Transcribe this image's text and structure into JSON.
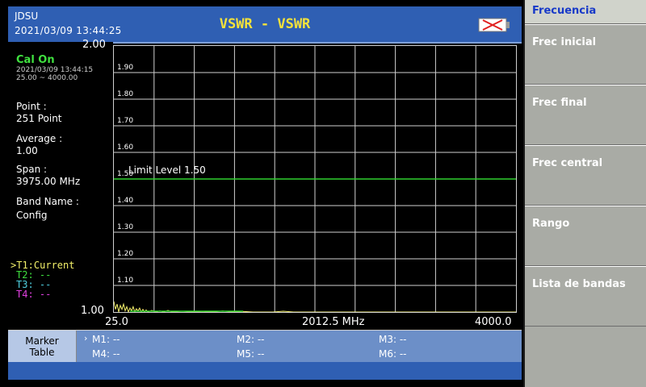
{
  "header": {
    "brand": "JDSU",
    "datetime": "2021/03/09 13:44:25",
    "mode_title": "VSWR - VSWR"
  },
  "info": {
    "cal_status": "Cal On",
    "cal_datetime": "2021/03/09 13:44:15",
    "cal_range": "25.00 ~ 4000.00",
    "point_label": "Point :",
    "point_value": "251 Point",
    "average_label": "Average :",
    "average_value": "1.00",
    "span_label": "Span :",
    "span_value": "3975.00 MHz",
    "band_label": "Band Name :",
    "band_value": "Config",
    "traces": [
      {
        "label": ">T1:Current",
        "color": "#f3f06a"
      },
      {
        "label": "T2: --",
        "color": "#3fe03f"
      },
      {
        "label": "T3: --",
        "color": "#4fd0e0"
      },
      {
        "label": "T4: --",
        "color": "#e040e0"
      }
    ]
  },
  "chart_data": {
    "type": "line",
    "ylim": [
      1.0,
      2.0
    ],
    "y_top_label": "2.00",
    "y_bottom_label": "1.00",
    "y_tick_labels": [
      "1.90",
      "1.80",
      "1.70",
      "1.60",
      "1.50",
      "1.40",
      "1.30",
      "1.20",
      "1.10"
    ],
    "x_labels": [
      "25.0",
      "2012.5 MHz",
      "4000.0"
    ],
    "xlim": [
      25.0,
      4000.0
    ],
    "limit_level": 1.5,
    "limit_label": "Limit Level 1.50",
    "grid": true,
    "series": [
      {
        "color": "#f3f06a",
        "x": [
          25,
          41,
          57,
          73,
          89,
          105,
          121,
          137,
          153,
          169,
          185,
          200,
          216,
          232,
          248,
          264,
          280,
          296,
          312,
          328,
          344,
          360,
          400,
          440,
          480,
          520,
          560,
          600,
          700,
          800,
          900,
          1000,
          1100,
          1200,
          1300,
          1400,
          1500,
          1600,
          1700,
          1800,
          1900,
          2000,
          2200,
          2400,
          2600,
          2800,
          3000,
          3200,
          3400,
          3600,
          3800,
          4000
        ],
        "y": [
          1.04,
          1.01,
          1.03,
          1.0,
          1.025,
          1.01,
          1.03,
          1.005,
          1.02,
          1.0,
          1.015,
          1.005,
          1.02,
          1.0,
          1.012,
          1.004,
          1.015,
          1.0,
          1.01,
          1.0,
          1.008,
          1.0,
          1.006,
          1.0,
          1.004,
          1.0,
          1.006,
          1.0,
          1.003,
          1.0,
          1.002,
          1.0,
          1.004,
          1.0,
          1.002,
          1.0,
          1.0,
          1.0,
          1.003,
          1.0,
          1.0,
          1.0,
          1.0,
          1.0,
          1.0,
          1.0,
          1.0,
          1.0,
          1.0,
          1.0,
          1.0,
          1.0
        ]
      }
    ]
  },
  "markers": {
    "title_line1": "Marker",
    "title_line2": "Table",
    "items": [
      "M1: --",
      "M2: --",
      "M3: --",
      "M4: --",
      "M5: --",
      "M6: --"
    ]
  },
  "menu": {
    "header": "Frecuencia",
    "buttons": [
      "Frec inicial",
      "Frec final",
      "Frec central",
      "Rango",
      "Lista de bandas"
    ]
  },
  "colors": {
    "header_bg": "#2f5fb3",
    "grid": "#cfcfcf",
    "limit_line": "#2fd02f",
    "trace": "#f3f06a"
  }
}
